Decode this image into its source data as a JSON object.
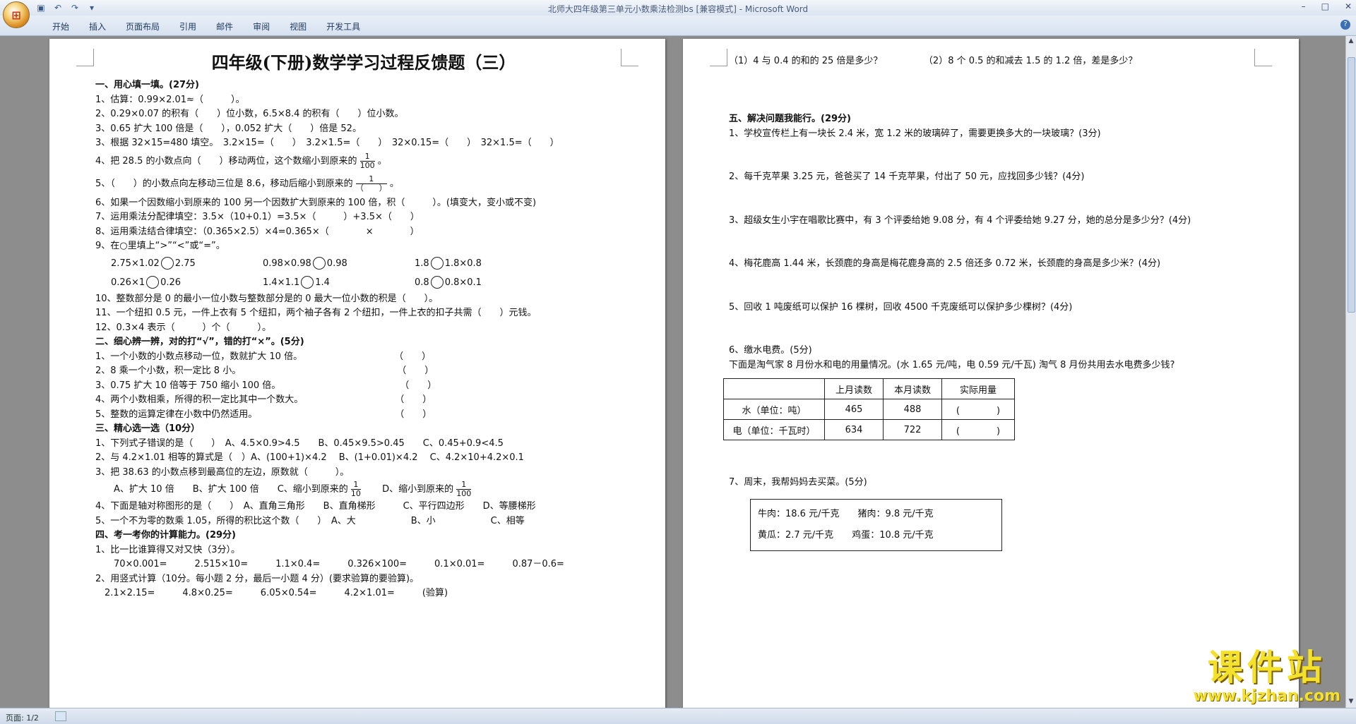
{
  "window": {
    "title": "北师大四年级第三单元小数乘法检测bs [兼容模式] - Microsoft Word",
    "controls": [
      "–",
      "□",
      "✕"
    ]
  },
  "ribbon": {
    "tabs": [
      "开始",
      "插入",
      "页面布局",
      "引用",
      "邮件",
      "审阅",
      "视图",
      "开发工具"
    ],
    "help": "?"
  },
  "page1": {
    "title": "四年级(下册)数学学习过程反馈题（三）",
    "lines": [
      {
        "cls": "sec",
        "text": "一、用心填一填。(27分)"
      },
      {
        "cls": "",
        "text": "1、估算：0.99×2.01≈（　　　）。"
      },
      {
        "cls": "",
        "text": "2、0.29×0.07 的积有（　　）位小数，6.5×8.4 的积有（　　）位小数。"
      },
      {
        "cls": "",
        "text": "3、0.65 扩大 100 倍是（　　），0.052 扩大（　　）倍是 52。"
      },
      {
        "cls": "",
        "text": "3、根据 32×15=480 填空。　3.2×15=（　　）　3.2×1.5=（　　）　32×0.15=（　　）　32×1.5=（　　）"
      }
    ],
    "q4a": "4、把 28.5 的小数点向（　　）移动两位，这个数缩小到原来的",
    "q4f": {
      "n": "1",
      "d": "100"
    },
    "q4b": "。",
    "q5a": "5、（　　）的小数点向左移动三位是 8.6，移动后缩小到原来的",
    "q5f": {
      "n": "1",
      "d": "（　　）"
    },
    "q5b": "。",
    "lines2": [
      {
        "cls": "",
        "text": "6、如果一个因数缩小到原来的 100 另一个因数扩大到原来的 100 倍，积（　　　）。(填变大，变小或不变)"
      },
      {
        "cls": "",
        "text": "7、运用乘法分配律填空：3.5×（10+0.1）=3.5×（　　　）+3.5×（　　）"
      },
      {
        "cls": "",
        "text": "8、运用乘法结合律填空：（0.365×2.5）×4=0.365×（　　　　×　　　　）"
      },
      {
        "cls": "",
        "text": "9、在○里填上“>”“<”或“=”。"
      }
    ],
    "compare": [
      [
        "2.75×1.02",
        "2.75",
        "0.98×0.98",
        "0.98",
        "1.8",
        "1.8×0.8"
      ],
      [
        "0.26×1",
        "0.26",
        "1.4×1.1",
        "1.4",
        "0.8",
        "0.8×0.1"
      ]
    ],
    "lines3": [
      {
        "cls": "",
        "text": "10、整数部分是 0 的最小一位小数与整数部分是的 0 最大一位小数的积是（　　）。"
      },
      {
        "cls": "",
        "text": "11、一个纽扣 0.5 元，一件上衣有 5 个纽扣，两个袖子各有 2 个纽扣，一件上衣的扣子共需（　　）元钱。"
      },
      {
        "cls": "",
        "text": "12、0.3×4 表示（　　　）个（　　　）。"
      },
      {
        "cls": "sec",
        "text": "二、细心辨一辨，对的打“√”，错的打“×”。(5分)"
      },
      {
        "cls": "",
        "text": "1、一个小数的小数点移动一位，数就扩大 10 倍。　　　　　　　　　　　（　　）"
      },
      {
        "cls": "",
        "text": "2、8 乘一个小数，积一定比 8 小。　　　　　　　　　　　　　　　　　　（　　）"
      },
      {
        "cls": "",
        "text": "3、0.75 扩大 10 倍等于 750 缩小 100 倍。　　　　　　　　　　　　　　（　　）"
      },
      {
        "cls": "",
        "text": "4、两个小数相乘，所得的积一定比其中一个数大。　　　　　　　　　　　（　　）"
      },
      {
        "cls": "",
        "text": "5、整数的运算定律在小数中仍然适用。　　　　　　　　　　　　　　　　（　　）"
      },
      {
        "cls": "sec",
        "text": "三、精心选一选（10分）"
      },
      {
        "cls": "",
        "text": "1、下列式子错误的是（　　）　A、4.5×0.9>4.5　　B、0.45×9.5>0.45　　C、0.45+0.9<4.5"
      },
      {
        "cls": "",
        "text": "2、与 4.2×1.01 相等的算式是（　）A、(100+1)×4.2　 B、(1+0.01)×4.2　 C、4.2×10+4.2×0.1"
      },
      {
        "cls": "",
        "text": "3、把 38.63 的小数点移到最高位的左边，原数就（　　　）。"
      }
    ],
    "q3opt_a": "　　A、扩大 10 倍　　B、扩大 100 倍　　C、缩小到原来的",
    "q3opt_f1": {
      "n": "1",
      "d": "10"
    },
    "q3opt_b": "　　D、缩小到原来的",
    "q3opt_f2": {
      "n": "1",
      "d": "100"
    },
    "lines4": [
      {
        "cls": "",
        "text": "4、下面是轴对称图形的是（　　）　A、直角三角形　　B、直角梯形　　　C、平行四边形　　D、等腰梯形"
      },
      {
        "cls": "",
        "text": "5、一个不为零的数乘 1.05，所得的积比这个数（　　）　A、大　　　　　　B、小　　　　　　C、相等"
      },
      {
        "cls": "sec",
        "text": "四、考一考你的计算能力。(29分)"
      },
      {
        "cls": "",
        "text": "1、比一比谁算得又对又快（3分）。"
      },
      {
        "cls": "",
        "text": "　　70×0.001=　　　2.515×10=　　　1.1×0.4=　　　0.326×100=　　　0.1×0.01=　　　0.87－0.6="
      },
      {
        "cls": "",
        "text": "2、用竖式计算（10分。每小题 2 分，最后一小题 4 分）(要求验算的要验算)。"
      },
      {
        "cls": "",
        "text": "　2.1×2.15=　　　4.8×0.25=　　　6.05×0.54=　　　4.2×1.01=　　　(验算)"
      }
    ]
  },
  "page2": {
    "lines": [
      {
        "cls": "",
        "text": "（1）4 与 0.4 的和的 25 倍是多少？　　　　　（2）8 个 0.5 的和减去 1.5 的 1.2 倍，差是多少？"
      },
      {
        "cls": "",
        "text": ""
      },
      {
        "cls": "",
        "text": ""
      },
      {
        "cls": "",
        "text": ""
      },
      {
        "cls": "sec",
        "text": "五、解决问题我能行。(29分)"
      },
      {
        "cls": "",
        "text": "1、学校宣传栏上有一块长 2.4 米，宽 1.2 米的玻璃碎了，需要更换多大的一块玻璃？(3分)"
      },
      {
        "cls": "",
        "text": ""
      },
      {
        "cls": "",
        "text": ""
      },
      {
        "cls": "",
        "text": "2、每千克苹果 3.25 元，爸爸买了 14 千克苹果，付出了 50 元，应找回多少钱？(4分)"
      },
      {
        "cls": "",
        "text": ""
      },
      {
        "cls": "",
        "text": ""
      },
      {
        "cls": "",
        "text": "3、超级女生小宇在唱歌比赛中，有 3 个评委给她 9.08 分，有 4 个评委给她 9.27 分，她的总分是多少分？(4分)"
      },
      {
        "cls": "",
        "text": ""
      },
      {
        "cls": "",
        "text": ""
      },
      {
        "cls": "",
        "text": "4、梅花鹿高 1.44 米，长颈鹿的身高是梅花鹿身高的 2.5 倍还多 0.72 米，长颈鹿的身高是多少米？(4分)"
      },
      {
        "cls": "",
        "text": ""
      },
      {
        "cls": "",
        "text": ""
      },
      {
        "cls": "",
        "text": "5、回收 1 吨废纸可以保护 16 棵树，回收 4500 千克废纸可以保护多少棵树？(4分)"
      },
      {
        "cls": "",
        "text": ""
      },
      {
        "cls": "",
        "text": ""
      },
      {
        "cls": "",
        "text": "6、缴水电费。(5分)"
      },
      {
        "cls": "",
        "text": "下面是淘气家 8 月份水和电的用量情况。(水 1.65 元/吨，电 0.59 元/千瓦) 淘气 8 月份共用去水电费多少钱?"
      }
    ],
    "table": {
      "headers": [
        "",
        "上月读数",
        "本月读数",
        "实际用量"
      ],
      "rows": [
        [
          "水（单位：吨）",
          "465",
          "488",
          "(　　　　)"
        ],
        [
          "电（单位：千瓦时）",
          "634",
          "722",
          "(　　　　)"
        ]
      ]
    },
    "q7": "7、周末，我帮妈妈去买菜。(5分)",
    "prices": [
      [
        "牛肉：18.6 元/千克",
        "猪肉：9.8 元/千克"
      ],
      [
        "黄瓜：2.7 元/千克",
        "鸡蛋：10.8 元/千克"
      ]
    ]
  },
  "status": {
    "page": "页面: 1/2"
  },
  "watermark": {
    "big": "课件站",
    "small": "www.kjzhan.com"
  }
}
